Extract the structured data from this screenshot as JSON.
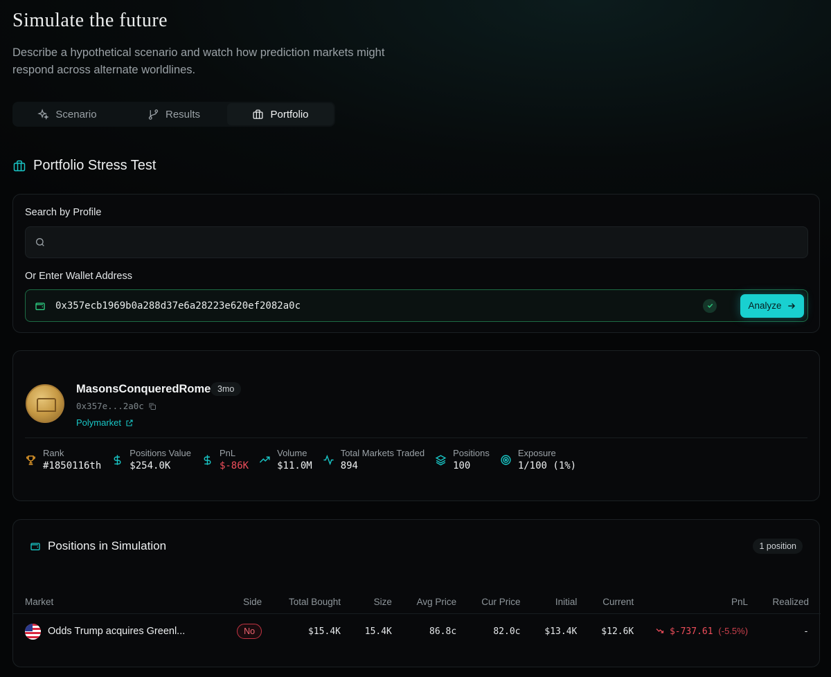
{
  "header": {
    "title": "Simulate the future",
    "subtitle": "Describe a hypothetical scenario and watch how prediction markets might respond across alternate worldlines."
  },
  "tabs": [
    {
      "label": "Scenario",
      "icon": "sparkles-icon",
      "active": false
    },
    {
      "label": "Results",
      "icon": "git-branch-icon",
      "active": false
    },
    {
      "label": "Portfolio",
      "icon": "briefcase-icon",
      "active": true
    }
  ],
  "section": {
    "title": "Portfolio Stress Test"
  },
  "search": {
    "profile_label": "Search by Profile",
    "profile_value": "",
    "wallet_label": "Or Enter Wallet Address",
    "wallet_value": "0x357ecb1969b0a288d37e6a28223e620ef2082a0c",
    "analyze_label": "Analyze"
  },
  "profile": {
    "username": "MasonsConqueredRome",
    "age": "3mo",
    "address": "0x357e...2a0c",
    "link_label": "Polymarket",
    "stats": [
      {
        "label": "Rank",
        "value": "#1850116th",
        "icon": "trophy-icon",
        "color": "#e39a2a"
      },
      {
        "label": "Positions Value",
        "value": "$254.0K",
        "icon": "dollar-icon",
        "color": "#19c6c6"
      },
      {
        "label": "PnL",
        "value": "$-86K",
        "icon": "dollar-icon",
        "color": "#19c6c6",
        "negative": true
      },
      {
        "label": "Volume",
        "value": "$11.0M",
        "icon": "trending-up-icon",
        "color": "#19c6c6"
      },
      {
        "label": "Total Markets Traded",
        "value": "894",
        "icon": "activity-icon",
        "color": "#19c6c6"
      },
      {
        "label": "Positions",
        "value": "100",
        "icon": "layers-icon",
        "color": "#19c6c6"
      },
      {
        "label": "Exposure",
        "value": "1/100 (1%)",
        "icon": "target-icon",
        "color": "#19c6c6"
      }
    ]
  },
  "positions": {
    "title": "Positions in Simulation",
    "count_label": "1 position",
    "columns": [
      "Market",
      "Side",
      "Total Bought",
      "Size",
      "Avg Price",
      "Cur Price",
      "Initial",
      "Current",
      "PnL",
      "Realized"
    ],
    "rows": [
      {
        "market": "Odds Trump acquires Greenl...",
        "side": "No",
        "total_bought": "$15.4K",
        "size": "15.4K",
        "avg_price": "86.8c",
        "cur_price": "82.0c",
        "initial": "$13.4K",
        "current": "$12.6K",
        "pnl": "$-737.61",
        "pnl_pct": "(-5.5%)",
        "realized": "-"
      }
    ]
  }
}
